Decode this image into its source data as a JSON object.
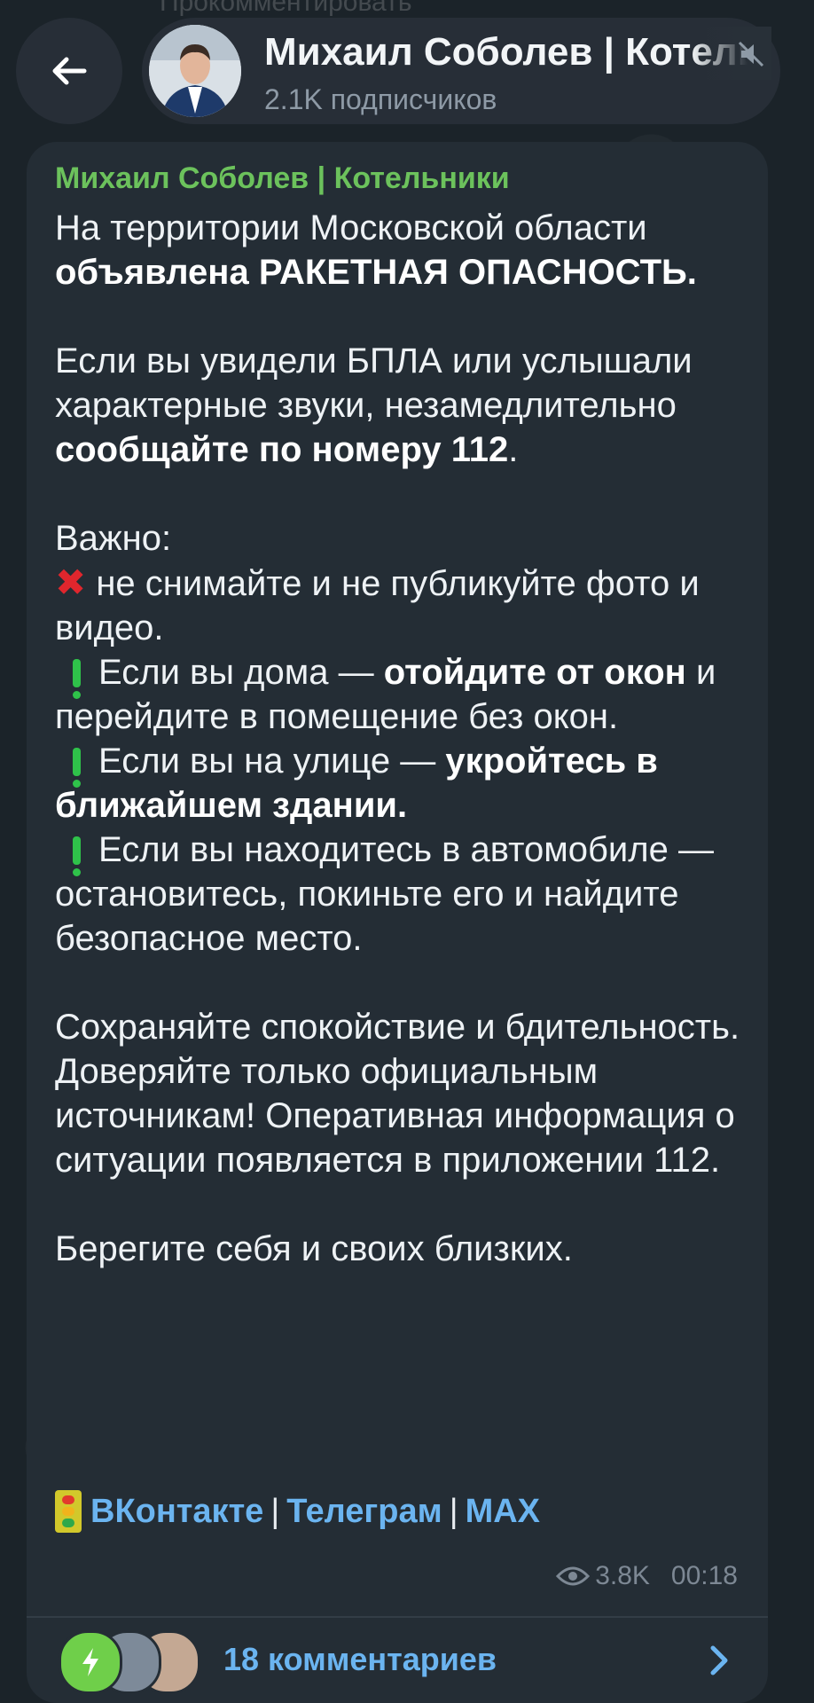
{
  "ghost_text": "Прокомментировать",
  "header": {
    "channel_title": "Михаил Соболев | Котельники",
    "subscribers": "2.1K подписчиков"
  },
  "post": {
    "author": "Михаил Соболев | Котельники",
    "p1_a": "На территории Московской области ",
    "p1_b": "объявлена РАКЕТНАЯ ОПАСНОСТЬ.",
    "p2_a": "Если вы увидели БПЛА или услышали характерные звуки, незамедлительно ",
    "p2_b": "сообщайте по номеру 112",
    "p2_c": ".",
    "important": "Важно:",
    "item1": " не снимайте и не публикуйте фото и видео.",
    "item2_a": "Если вы дома — ",
    "item2_b": "отойдите от окон",
    "item2_c": " и перейдите в помещение без окон.",
    "item3_a": "Если вы на улице — ",
    "item3_b": "укройтесь в ближайшем здании.",
    "item4": "Если вы находитесь в автомобиле — остановитесь, покиньте его и найдите безопасное место.",
    "p4": "Сохраняйте спокойствие и бдительность. Доверяйте только официальным источникам! Оперативная информация о ситуации появляется в приложении 112.",
    "p5": "Берегите себя и своих близких.",
    "links": [
      "ВКонтакте",
      "Телеграм",
      "MAX"
    ],
    "link_separator": "|",
    "views": "3.8K",
    "time": "00:18",
    "comments_label": "18 комментариев"
  },
  "colors": {
    "author": "#6cc25c",
    "link": "#6bb4f0",
    "bubble": "#242d35"
  }
}
